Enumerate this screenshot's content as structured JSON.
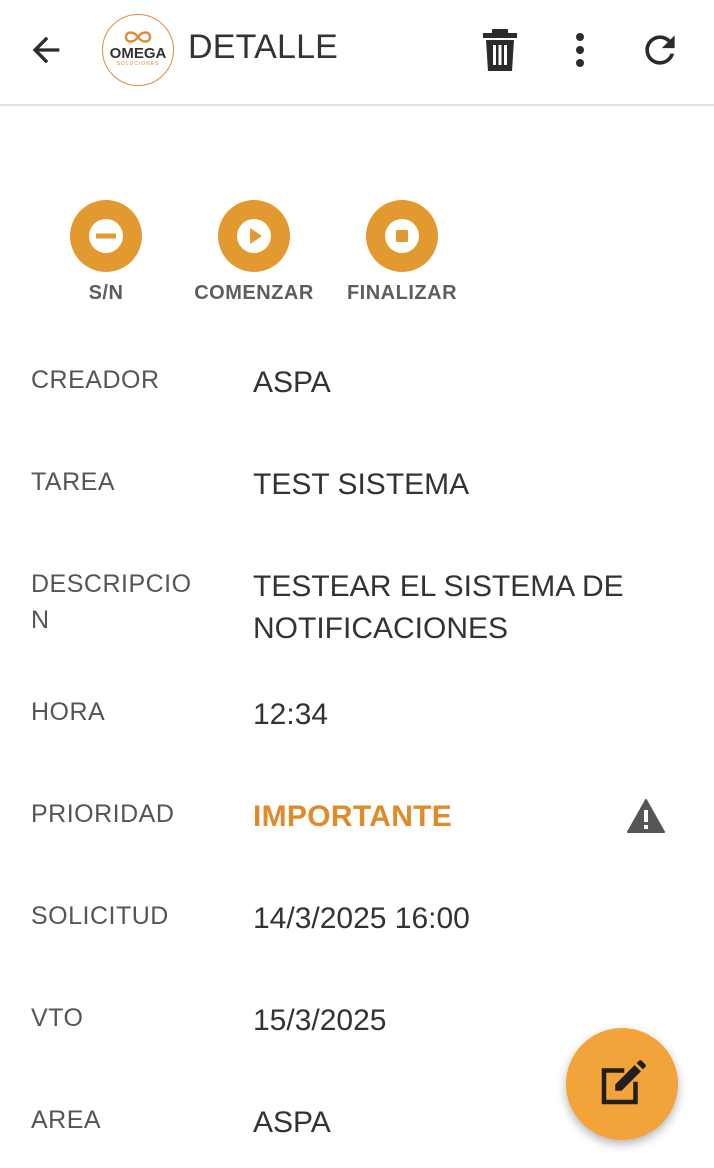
{
  "header": {
    "title": "DETALLE",
    "logo_name": "OMEGA",
    "logo_sub": "SOLUCIONES",
    "back_icon": "arrow-left-icon",
    "delete_icon": "trash-icon",
    "more_icon": "more-vertical-icon",
    "refresh_icon": "refresh-icon"
  },
  "actions": [
    {
      "label": "S/N",
      "icon": "minus-circle-icon"
    },
    {
      "label": "COMENZAR",
      "icon": "play-circle-icon"
    },
    {
      "label": "FINALIZAR",
      "icon": "stop-circle-icon"
    }
  ],
  "details": {
    "creador": {
      "label": "CREADOR",
      "value": "ASPA"
    },
    "tarea": {
      "label": "TAREA",
      "value": "TEST SISTEMA"
    },
    "descripcion": {
      "label": "DESCRIPCIO N",
      "value": "TESTEAR EL SISTEMA DE NOTIFICACIONES"
    },
    "hora": {
      "label": "HORA",
      "value": "12:34"
    },
    "prioridad": {
      "label": "PRIORIDAD",
      "value": "IMPORTANTE",
      "icon": "warning-icon"
    },
    "solicitud": {
      "label": "SOLICITUD",
      "value": "14/3/2025 16:00"
    },
    "vto": {
      "label": "VTO",
      "value": "15/3/2025"
    },
    "area": {
      "label": "AREA",
      "value": "ASPA"
    }
  },
  "fab": {
    "icon": "edit-icon"
  },
  "colors": {
    "accent": "#e2992f",
    "priority_text": "#e08a2a",
    "fab": "#f2a33a",
    "text": "#333333",
    "label_text": "#555555"
  }
}
